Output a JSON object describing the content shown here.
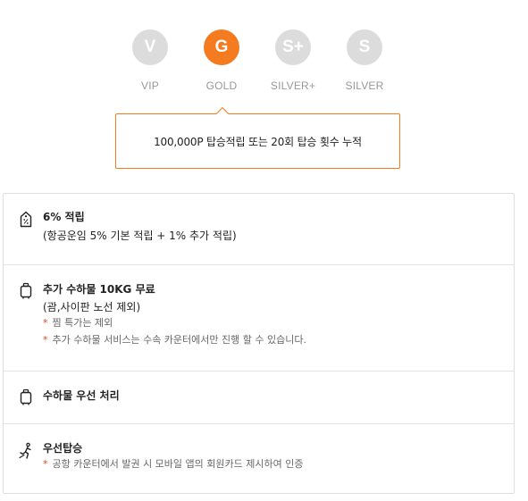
{
  "tiers": [
    {
      "letter": "V",
      "label": "VIP"
    },
    {
      "letter": "G",
      "label": "GOLD"
    },
    {
      "letter": "S+",
      "label": "SILVER+"
    },
    {
      "letter": "S",
      "label": "SILVER"
    }
  ],
  "selected_tier": "GOLD",
  "tooltip": {
    "text": "100,000P 탑승적립 또는 20회 탑승 횟수 누적"
  },
  "benefits": [
    {
      "icon": "price-tag-icon",
      "title": "6% 적립",
      "sub": "(항공운임 5% 기본 적립 + 1% 추가 적립)",
      "notes": []
    },
    {
      "icon": "luggage-icon",
      "title": "추가 수하물 10KG 무료",
      "sub": "(괌,사이판 노선 제외)",
      "notes": [
        "찜 특가는 제외",
        "추가 수하물 서비스는 수속 카운터에서만 진행 할 수 있습니다."
      ]
    },
    {
      "icon": "luggage-icon",
      "title": "수하물 우선 처리",
      "sub": "",
      "notes": []
    },
    {
      "icon": "priority-boarding-icon",
      "title": "우선탑승",
      "sub": "",
      "notes": [
        "공항 카운터에서 발권 시 모바일 앱의 회원카드 제시하여 인증"
      ]
    }
  ],
  "colors": {
    "accent": "#f47b20",
    "inactive": "#dcdcdc",
    "note_star": "#e8402a",
    "border": "#dedede"
  }
}
